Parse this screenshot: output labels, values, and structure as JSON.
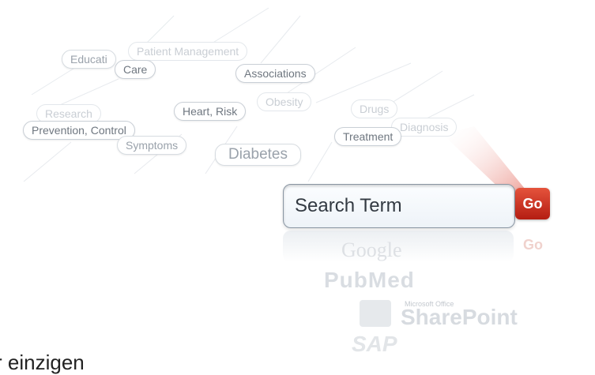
{
  "tags": [
    {
      "label": "Educati",
      "kind": "mid"
    },
    {
      "label": "Patient Management",
      "kind": "faint"
    },
    {
      "label": "Care",
      "kind": "normal"
    },
    {
      "label": "Associations",
      "kind": "normal"
    },
    {
      "label": "Obesity",
      "kind": "faint"
    },
    {
      "label": "Research",
      "kind": "faint"
    },
    {
      "label": "Heart, Risk",
      "kind": "normal"
    },
    {
      "label": "Prevention, Control",
      "kind": "normal"
    },
    {
      "label": "Symptoms",
      "kind": "mid"
    },
    {
      "label": "Diabetes",
      "kind": "mid"
    },
    {
      "label": "Drugs",
      "kind": "faint"
    },
    {
      "label": "Diagnosis",
      "kind": "faint"
    },
    {
      "label": "Treatment",
      "kind": "normal"
    }
  ],
  "search": {
    "term": "Search Term",
    "go_label": "Go"
  },
  "reflections": {
    "google": "Google",
    "pubmed": "PubMed",
    "microsoft_office": "Microsoft Office",
    "sharepoint": "SharePoint",
    "sap": "SAP"
  },
  "bottom_text": "r einzigen"
}
